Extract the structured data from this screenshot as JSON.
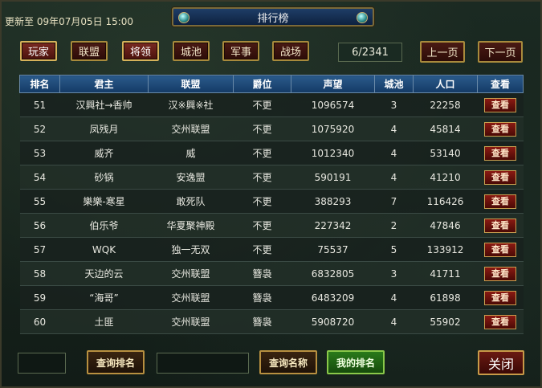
{
  "header": {
    "updated_text": "更新至 09年07月05日 15:00",
    "title": "排行榜"
  },
  "tabs": [
    {
      "label": "玩家",
      "active": true
    },
    {
      "label": "联盟",
      "active": false
    },
    {
      "label": "将领",
      "active": true
    },
    {
      "label": "城池",
      "active": false
    },
    {
      "label": "军事",
      "active": false
    },
    {
      "label": "战场",
      "active": false
    }
  ],
  "pager": {
    "page_text": "6/2341",
    "prev_label": "上一页",
    "next_label": "下一页"
  },
  "table": {
    "columns": [
      "排名",
      "君主",
      "联盟",
      "爵位",
      "声望",
      "城池",
      "人口",
      "查看"
    ],
    "view_label": "查看",
    "rows": [
      {
        "rank": "51",
        "lord": "汉興社→香帅",
        "alliance": "汉※興※社",
        "title": "不更",
        "prestige": "1096574",
        "cities": "3",
        "population": "22258"
      },
      {
        "rank": "52",
        "lord": "凤残月",
        "alliance": "交州联盟",
        "title": "不更",
        "prestige": "1075920",
        "cities": "4",
        "population": "45814"
      },
      {
        "rank": "53",
        "lord": "威齐",
        "alliance": "威",
        "title": "不更",
        "prestige": "1012340",
        "cities": "4",
        "population": "53140"
      },
      {
        "rank": "54",
        "lord": "砂锅",
        "alliance": "安逸盟",
        "title": "不更",
        "prestige": "590191",
        "cities": "4",
        "population": "41210"
      },
      {
        "rank": "55",
        "lord": "樂樂-寒星",
        "alliance": "敢死队",
        "title": "不更",
        "prestige": "388293",
        "cities": "7",
        "population": "116426"
      },
      {
        "rank": "56",
        "lord": "伯乐爷",
        "alliance": "华夏聚神殿",
        "title": "不更",
        "prestige": "227342",
        "cities": "2",
        "population": "47846"
      },
      {
        "rank": "57",
        "lord": "WQK",
        "alliance": "独一无双",
        "title": "不更",
        "prestige": "75537",
        "cities": "5",
        "population": "133912"
      },
      {
        "rank": "58",
        "lord": "天边的云",
        "alliance": "交州联盟",
        "title": "簪袅",
        "prestige": "6832805",
        "cities": "3",
        "population": "41711"
      },
      {
        "rank": "59",
        "lord": "“海哥”",
        "alliance": "交州联盟",
        "title": "簪袅",
        "prestige": "6483209",
        "cities": "4",
        "population": "61898"
      },
      {
        "rank": "60",
        "lord": "土匪",
        "alliance": "交州联盟",
        "title": "簪袅",
        "prestige": "5908720",
        "cities": "4",
        "population": "55902"
      }
    ]
  },
  "footer": {
    "search_rank_label": "查询排名",
    "search_name_label": "查询名称",
    "my_rank_label": "我的排名",
    "close_label": "关闭"
  }
}
